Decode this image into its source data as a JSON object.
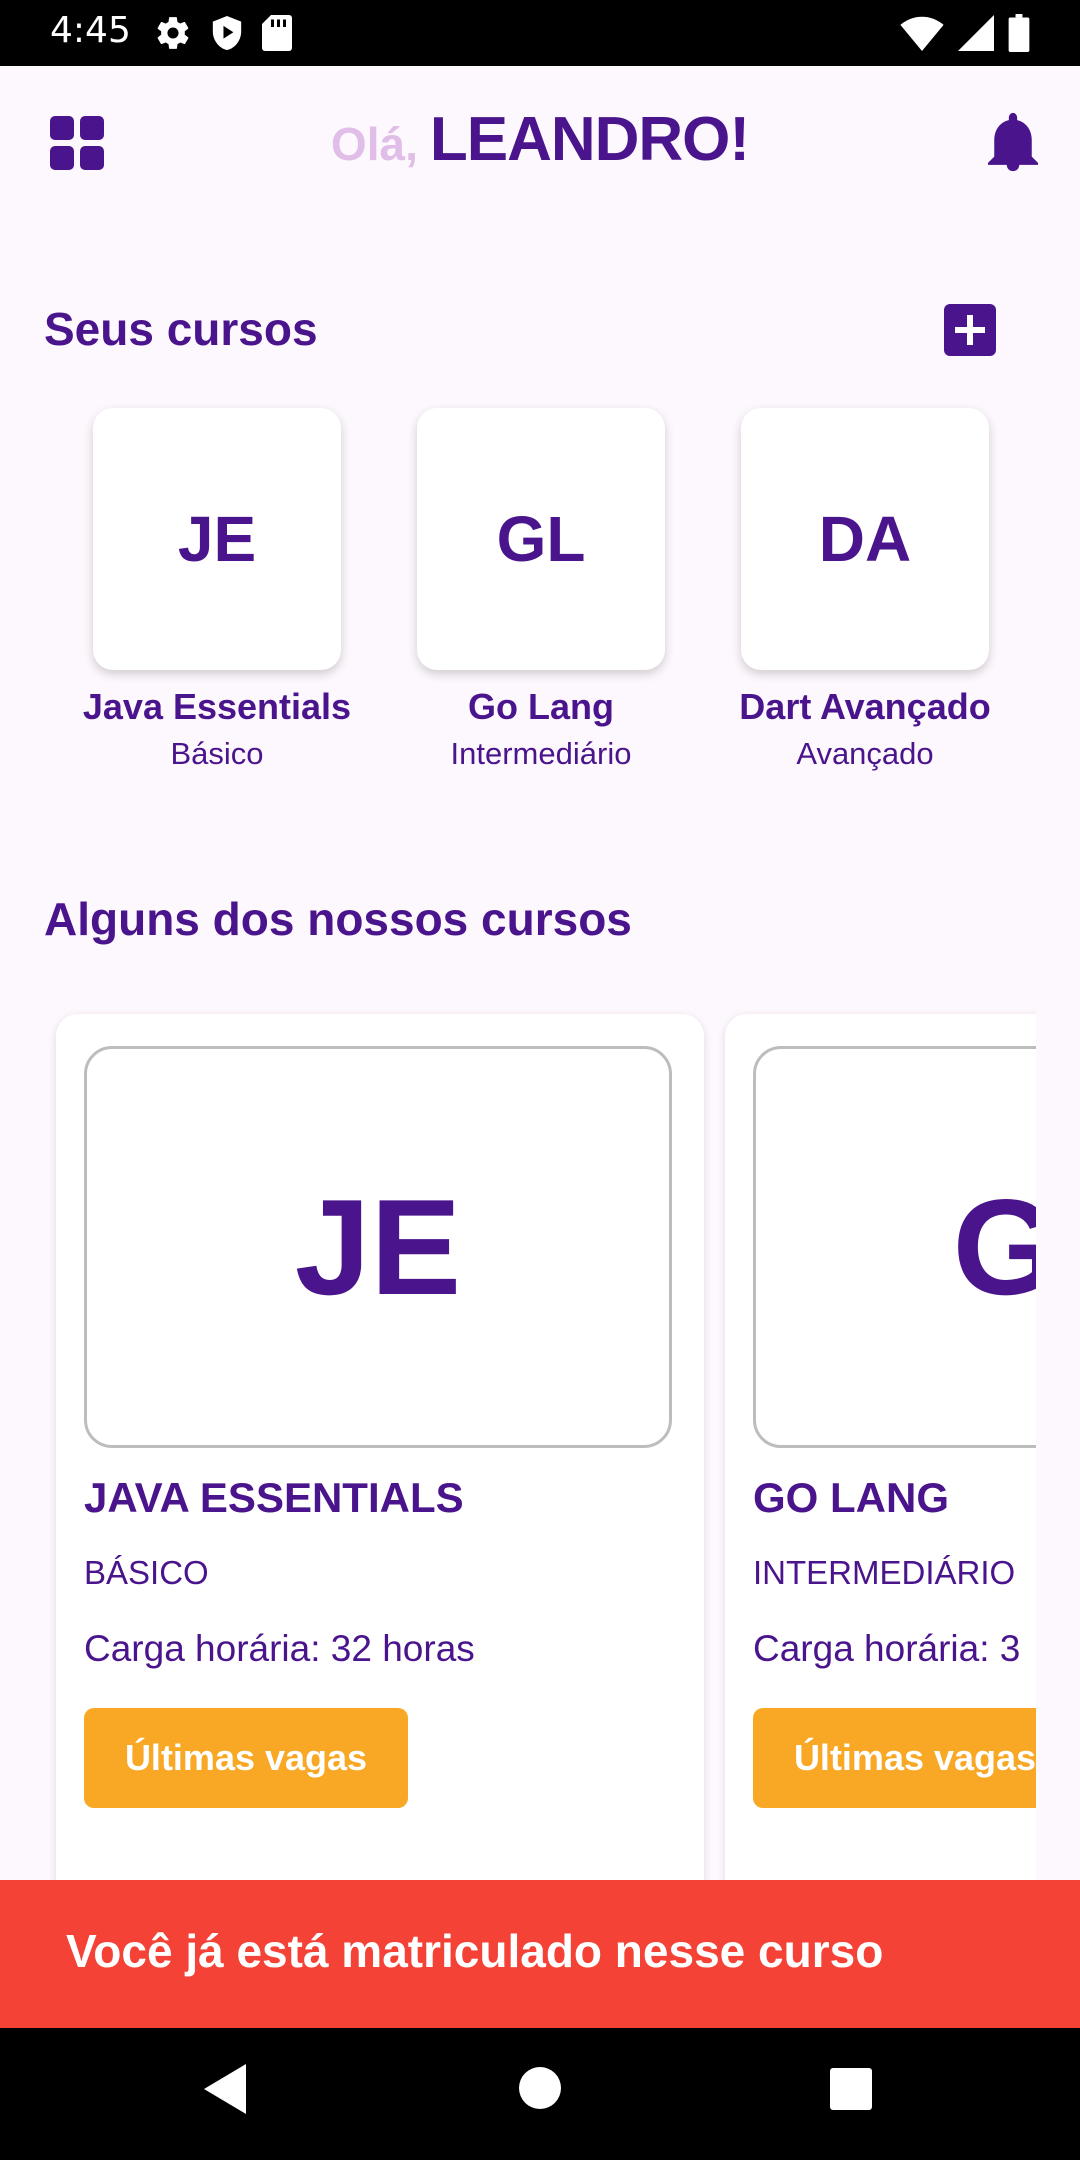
{
  "status_bar": {
    "time": "4:45"
  },
  "header": {
    "greeting": "Olá,",
    "user_name": "LEANDRO!"
  },
  "my_courses": {
    "title": "Seus cursos",
    "items": [
      {
        "initials": "JE",
        "name": "Java Essentials",
        "level": "Básico"
      },
      {
        "initials": "GL",
        "name": "Go Lang",
        "level": "Intermediário"
      },
      {
        "initials": "DA",
        "name": "Dart Avançado",
        "level": "Avançado"
      }
    ]
  },
  "featured_courses": {
    "title": "Alguns dos nossos cursos",
    "items": [
      {
        "initials": "JE",
        "title": "JAVA ESSENTIALS",
        "level": "BÁSICO",
        "hours": "Carga horária: 32 horas",
        "button": "Últimas vagas"
      },
      {
        "initials": "GL",
        "title": "GO LANG",
        "level": "INTERMEDIÁRIO",
        "hours": "Carga horária: 3",
        "button": "Últimas vagas"
      }
    ]
  },
  "snackbar": {
    "message": "Você já está matriculado nesse curso"
  },
  "colors": {
    "primary": "#4a148c",
    "accent": "#f9a825",
    "error": "#f44336",
    "greeting": "#e1bee7"
  }
}
